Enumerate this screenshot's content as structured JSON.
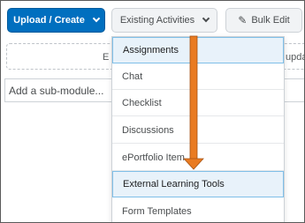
{
  "toolbar": {
    "upload_label": "Upload / Create",
    "existing_label": "Existing Activities",
    "bulk_edit_label": "Bulk Edit"
  },
  "background": {
    "drop_zone_fragment_left": "E",
    "drop_zone_fragment_right": "updat",
    "submodule_placeholder": "Add a sub-module..."
  },
  "menu": {
    "items": [
      {
        "label": "Assignments",
        "highlighted": true
      },
      {
        "label": "Chat",
        "highlighted": false
      },
      {
        "label": "Checklist",
        "highlighted": false
      },
      {
        "label": "Discussions",
        "highlighted": false
      },
      {
        "label": "ePortfolio Item",
        "highlighted": false
      },
      {
        "label": "External Learning Tools",
        "highlighted": true
      },
      {
        "label": "Form Templates",
        "highlighted": false
      }
    ]
  },
  "colors": {
    "primary_button": "#006fbf",
    "highlight_bg": "#e8f2fa",
    "highlight_border": "#7fbfe8",
    "arrow": "#e97b22"
  },
  "annotation": {
    "arrow_icon": "down-arrow-icon"
  }
}
